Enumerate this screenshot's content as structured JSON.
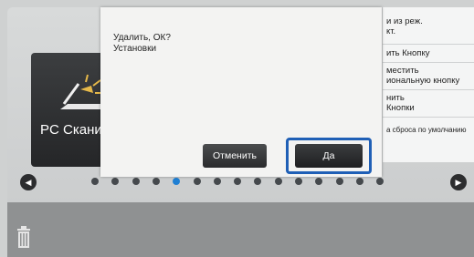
{
  "dialog": {
    "line1": "Удалить, ОК?",
    "line2": "Установки",
    "cancel_label": "Отменить",
    "ok_label": "Да"
  },
  "tile": {
    "label": "PC Скани",
    "icon": "scanner-icon"
  },
  "side_menu": [
    {
      "text": "и из реж.\nкт."
    },
    {
      "text": "ить Кнопку"
    },
    {
      "text": "местить\nиональную кнопку"
    },
    {
      "text": "нить\nКнопки"
    },
    {
      "text": "а сброса по умолчанию"
    }
  ],
  "pager": {
    "dot_count": 15,
    "active_index": 4,
    "prev_icon": "chevron-left-icon",
    "next_icon": "chevron-right-icon"
  },
  "bottom_bar": {
    "trash_icon": "trash-icon"
  },
  "colors": {
    "accent": "#1f5fb6",
    "active_dot": "#1f7fd3"
  }
}
